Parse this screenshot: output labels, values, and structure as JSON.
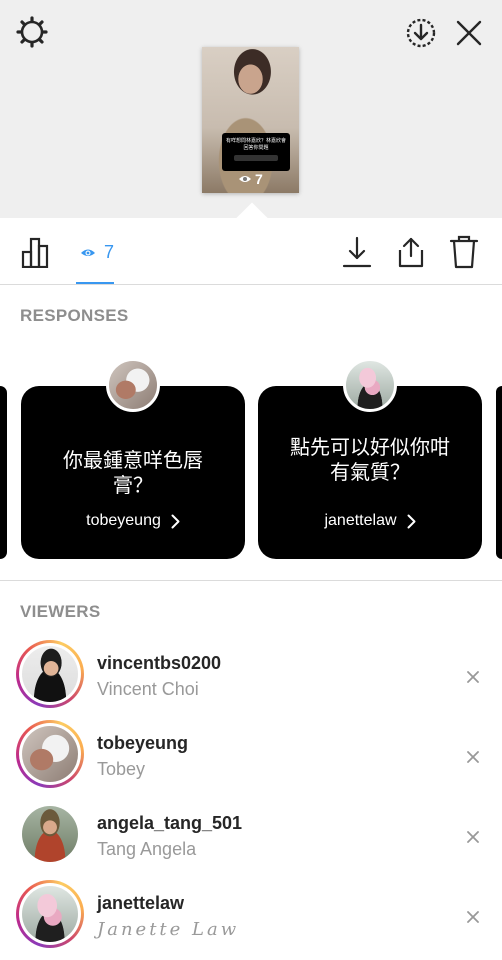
{
  "story": {
    "thumbnail_question": "有咩想問林嘉欣？林嘉欣會回答你問題",
    "thumbnail_input_placeholder": "輸入內容",
    "thumbnail_view_count": "7"
  },
  "action_bar": {
    "viewers_count": "7",
    "accent_color": "#3897f0"
  },
  "responses": {
    "title": "RESPONSES",
    "cards": [
      {
        "question": "你最鍾意咩色唇膏？",
        "username": "tobeyeung"
      },
      {
        "question": "點先可以好似你咁有氣質？",
        "username": "janettelaw"
      }
    ]
  },
  "viewers": {
    "title": "VIEWERS",
    "list": [
      {
        "username": "vincentbs0200",
        "full_name": "Vincent Choi",
        "has_story_ring": true
      },
      {
        "username": "tobeyeung",
        "full_name": "Tobey",
        "has_story_ring": true
      },
      {
        "username": "angela_tang_501",
        "full_name": "Tang Angela",
        "has_story_ring": false
      },
      {
        "username": "janettelaw",
        "full_name": "Janette Law",
        "has_story_ring": true
      }
    ]
  },
  "icons": [
    "gear-icon",
    "save-story-icon",
    "close-icon",
    "insights-chart-icon",
    "eye-icon",
    "download-icon",
    "share-icon",
    "trash-icon",
    "chevron-right-icon",
    "remove-icon"
  ]
}
